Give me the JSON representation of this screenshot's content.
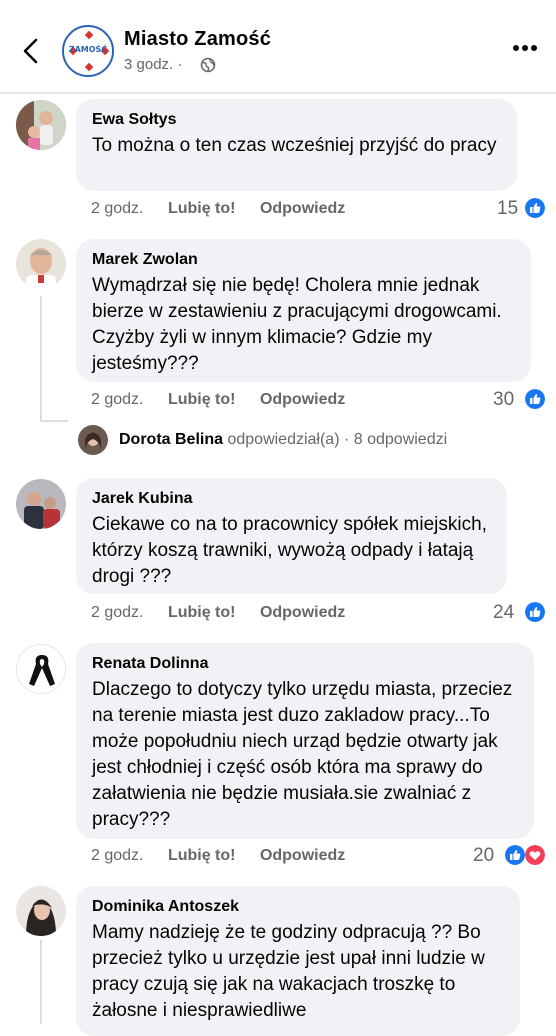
{
  "header": {
    "page_name": "Miasto Zamość",
    "time": "3 godz. ·",
    "logo_text": "ZAMOŚĆ"
  },
  "comments": [
    {
      "author": "Ewa Sołtys",
      "text": "To można o ten czas wcześniej przyjść do pracy",
      "time": "2 godz.",
      "like": "Lubię to!",
      "reply": "Odpowiedz",
      "count": "15"
    },
    {
      "author": "Marek Zwolan",
      "text": "Wymądrzał się nie będę! Cholera mnie jednak bierze w zestawieniu z pracującymi drogowcami. Czyżby żyli w innym klimacie? Gdzie my jesteśmy???",
      "time": "2 godz.",
      "like": "Lubię to!",
      "reply": "Odpowiedz",
      "count": "30"
    },
    {
      "author": "Jarek Kubina",
      "text": "Ciekawe co na to pracownicy spółek miejskich, którzy koszą trawniki, wywożą odpady i łatają drogi ???",
      "time": "2 godz.",
      "like": "Lubię to!",
      "reply": "Odpowiedz",
      "count": "24"
    },
    {
      "author": "Renata Dolinna",
      "text": "Dlaczego to dotyczy tylko urzędu miasta, przeciez na terenie miasta jest duzo zakladow pracy...To może popołudniu niech urząd będzie otwarty jak jest chłodniej i część osób która ma sprawy do załatwienia nie będzie musiała.sie zwalniać z pracy???",
      "time": "2 godz.",
      "like": "Lubię to!",
      "reply": "Odpowiedz",
      "count": "20"
    },
    {
      "author": "Dominika Antoszek",
      "text": "Mamy nadzieję że te godziny odpracują ?? Bo przecież tylko u urzędzie jest upał inni ludzie w pracy czują się jak na wakacjach troszkę to żałosne i niesprawiedliwe"
    }
  ],
  "reply_summary": {
    "name": "Dorota Belina",
    "action": "odpowiedział(a)",
    "count": "· 8 odpowiedzi"
  },
  "icons": [
    "back-arrow-icon",
    "globe-icon",
    "more-icon",
    "like-reaction-icon",
    "heart-reaction-icon"
  ],
  "colors": {
    "accent": "#1877f2",
    "bubble": "#f0f2f5",
    "meta": "#65676b",
    "heart": "#f33e58"
  }
}
